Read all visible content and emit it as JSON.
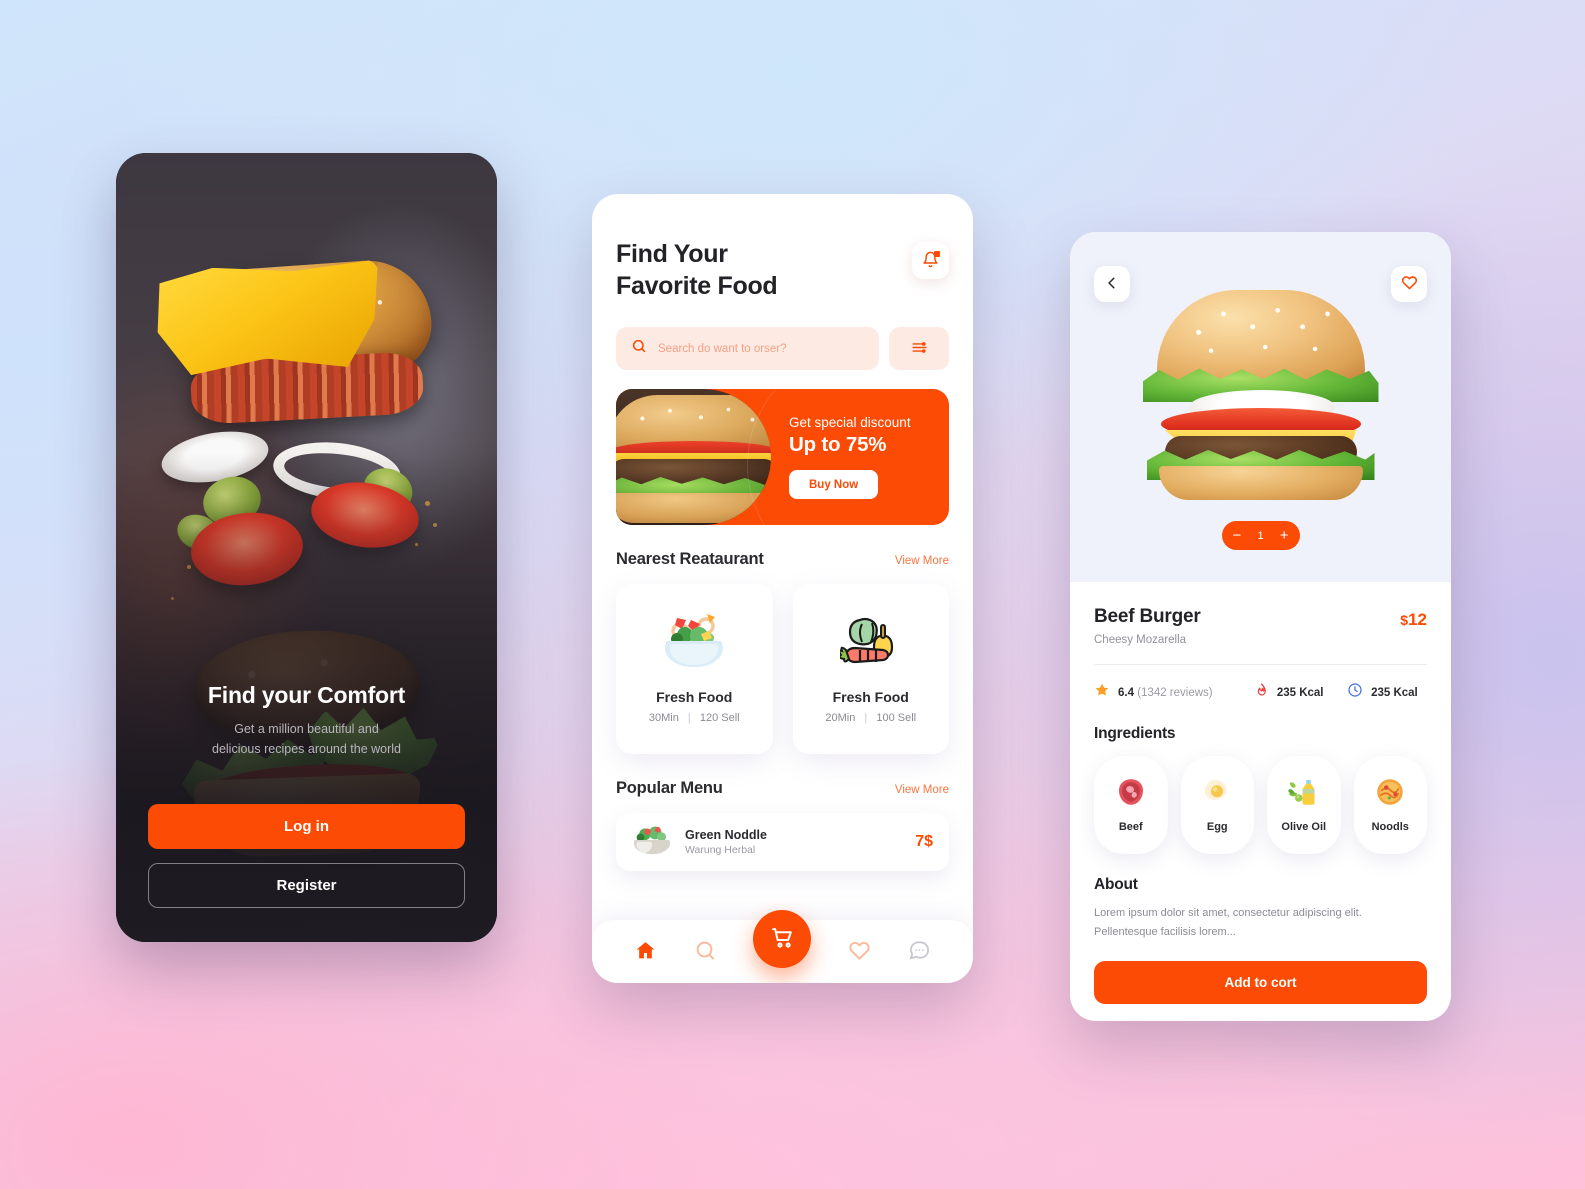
{
  "theme": {
    "accent": "#FB4B05",
    "accent_soft": "#FDEAE2",
    "dark_panel": "#201d24"
  },
  "onboarding": {
    "title": "Find your Comfort",
    "subtitle_line1": "Get a million beautiful and",
    "subtitle_line2": "delicious recipes around the world",
    "login_label": "Log in",
    "register_label": "Register"
  },
  "home": {
    "title_line1": "Find Your",
    "title_line2": "Favorite Food",
    "bell_icon": "bell-icon",
    "search": {
      "placeholder": "Search do want to orser?",
      "value": "",
      "icon": "search-icon"
    },
    "filter_icon": "sliders-icon",
    "banner": {
      "eyebrow": "Get special discount",
      "headline": "Up to 75%",
      "cta_label": "Buy Now"
    },
    "nearest": {
      "section_title": "Nearest Reataurant",
      "view_more": "View More",
      "cards": [
        {
          "icon": "salad-bowl-icon",
          "name": "Fresh Food",
          "time": "30Min",
          "sold": "120 Sell"
        },
        {
          "icon": "vegetables-icon",
          "name": "Fresh Food",
          "time": "20Min",
          "sold": "100 Sell"
        }
      ]
    },
    "popular": {
      "section_title": "Popular Menu",
      "view_more": "View More",
      "items": [
        {
          "icon": "salad-bowl-icon",
          "name": "Green Noddle",
          "vendor": "Warung Herbal",
          "price": "7$"
        }
      ]
    },
    "tabbar": [
      {
        "icon": "home-icon",
        "name": "tab-home",
        "active": true
      },
      {
        "icon": "search-icon",
        "name": "tab-search",
        "active": false
      },
      {
        "icon": "cart-icon",
        "name": "tab-cart",
        "active": false
      },
      {
        "icon": "heart-icon",
        "name": "tab-favorites",
        "active": false
      },
      {
        "icon": "chat-icon",
        "name": "tab-messages",
        "active": false
      }
    ]
  },
  "detail": {
    "back_icon": "chevron-left-icon",
    "favorite_icon": "heart-icon",
    "hero_image_alt": "beef-burger-photo",
    "quantity": {
      "minus": "−",
      "value": "1",
      "plus": "+"
    },
    "name": "Beef Burger",
    "subtitle": "Cheesy Mozarella",
    "price_currency": "$",
    "price_value": "12",
    "stats": [
      {
        "icon": "star-icon",
        "value": "6.4",
        "suffix": "(1342 reviews)"
      },
      {
        "icon": "flame-icon",
        "value": "235 Kcal",
        "suffix": ""
      },
      {
        "icon": "clock-icon",
        "value": "235 Kcal",
        "suffix": ""
      }
    ],
    "ingredients_title": "Ingredients",
    "ingredients": [
      {
        "icon": "beef-icon",
        "label": "Beef"
      },
      {
        "icon": "egg-icon",
        "label": "Egg"
      },
      {
        "icon": "olive-oil-icon",
        "label": "Olive Oil"
      },
      {
        "icon": "noodles-icon",
        "label": "Noodls"
      }
    ],
    "about_title": "About",
    "about_text": "Lorem ipsum dolor sit amet, consectetur adipiscing elit. Pellentesque facilisis lorem...",
    "add_to_cart_label": "Add to cort"
  }
}
